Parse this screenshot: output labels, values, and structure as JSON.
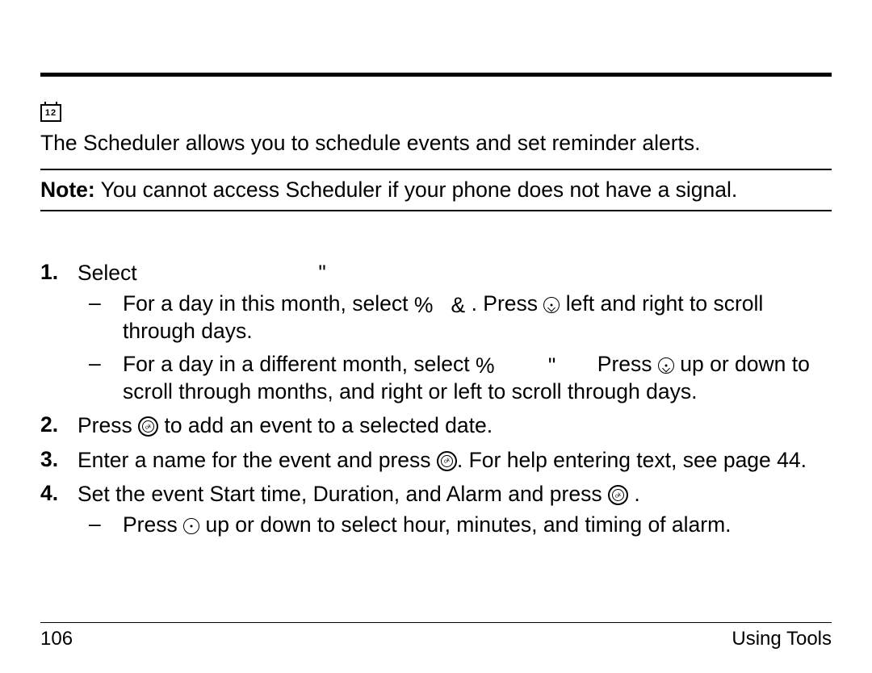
{
  "icon": {
    "calendar_digits": "12"
  },
  "intro": "The Scheduler allows you to schedule events and set reminder alerts.",
  "note": {
    "label": "Note:",
    "text": " You cannot access Scheduler if your phone does not have a signal."
  },
  "steps": [
    {
      "text_a": "Select ",
      "text_b": "\"",
      "subs": [
        {
          "a": "For a day in this month, select ",
          "sym1": "%",
          "b": "   ",
          "sym2": "&",
          "c": "   . Press ",
          "d": " left and right to scroll through days."
        },
        {
          "a": "For a day in a different month, select ",
          "sym1": "%",
          "b": "         ",
          "sym2": "\"",
          "c": "       Press ",
          "d": " up or down to scroll through months, and right or left to scroll through days."
        }
      ]
    },
    {
      "a": "Press ",
      "b": " to add an event to a selected date."
    },
    {
      "a": "Enter a name for the event and press ",
      "b": ". For help entering text, see page 44."
    },
    {
      "a": "Set the event Start time, Duration, and Alarm and press ",
      "b": " .",
      "subs": [
        {
          "a": "Press ",
          "b": " up or down to select hour, minutes, and timing of alarm."
        }
      ]
    }
  ],
  "footer": {
    "page": "106",
    "section": "Using Tools"
  }
}
